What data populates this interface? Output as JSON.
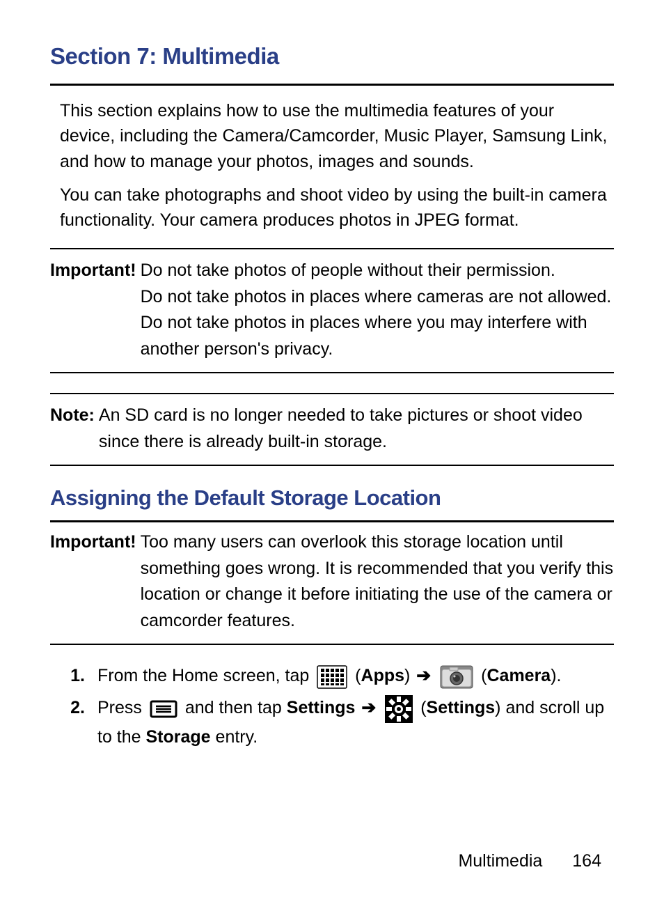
{
  "section_title": "Section 7: Multimedia",
  "paragraphs": {
    "p1": "This section explains how to use the multimedia features of your device, including the Camera/Camcorder, Music Player, Samsung Link, and how to manage your photos, images and sounds.",
    "p2": "You can take photographs and shoot video by using the built-in camera functionality. Your camera produces photos in JPEG format."
  },
  "important1": {
    "label": "Important!",
    "line1": "Do not take photos of people without their permission.",
    "line2": "Do not take photos in places where cameras are not allowed.",
    "line3": "Do not take photos in places where you may interfere with another person's privacy."
  },
  "note": {
    "label": "Note:",
    "text": "An SD card is no longer needed to take pictures or shoot video since there is already built-in storage."
  },
  "subheading": "Assigning the Default Storage Location",
  "important2": {
    "label": "Important!",
    "text": "Too many users can overlook this storage location until something goes wrong. It is recommended that you verify this location or change it before initiating the use of the camera or camcorder features."
  },
  "steps": {
    "s1": {
      "num": "1.",
      "pre": "From the Home screen, tap ",
      "apps_label": "Apps",
      "camera_label": "Camera"
    },
    "s2": {
      "num": "2.",
      "pre": "Press ",
      "mid": " and then tap ",
      "settings1": "Settings",
      "settings2": "Settings",
      "tail_a": " and scroll up to the ",
      "storage": "Storage",
      "tail_b": " entry."
    }
  },
  "arrow": "➔",
  "footer": {
    "label": "Multimedia",
    "page": "164"
  }
}
